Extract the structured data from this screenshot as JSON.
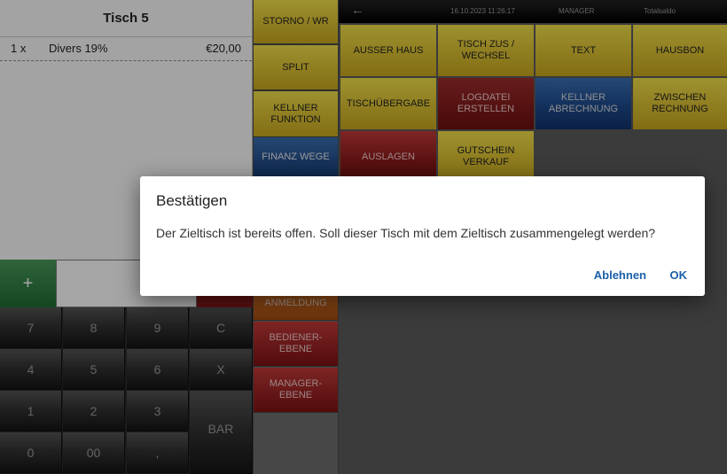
{
  "order": {
    "table_title": "Tisch 5",
    "rows": [
      {
        "qty": "1 x",
        "item": "Divers 19%",
        "price": "€20,00"
      }
    ]
  },
  "input": {
    "plus": "+"
  },
  "keypad": {
    "keys": [
      "7",
      "8",
      "9",
      "C",
      "4",
      "5",
      "6",
      "X",
      "1",
      "2",
      "3",
      "0",
      "00",
      ","
    ],
    "bar": "BAR"
  },
  "middle": {
    "storno": "STORNO / WR",
    "split": "SPLIT",
    "kellner_funktion": "KELLNER FUNKTION",
    "finanz_wege": "FINANZ WEGE",
    "anmeldung": "ANMELDUNG",
    "bediener_ebene": "BEDIENER-EBENE",
    "manager_ebene": "MANAGER-EBENE"
  },
  "status": {
    "datetime": "16.10.2023 11:26:17",
    "role": "MANAGER",
    "mode": "Totalsaldo"
  },
  "grid": {
    "ausser_haus": "AUSSER HAUS",
    "tisch_zus": "TISCH ZUS / WECHSEL",
    "text": "TEXT",
    "hausbon": "HAUSBON",
    "tischuebergabe": "TISCHÜBERGABE",
    "logdatei": "LOGDATEI ERSTELLEN",
    "kellner_abrechnung": "KELLNER ABRECHNUNG",
    "zwischen_rechnung": "ZWISCHEN RECHNUNG",
    "auslagen": "AUSLAGEN",
    "gutschein": "GUTSCHEIN VERKAUF"
  },
  "dialog": {
    "title": "Bestätigen",
    "message": "Der Zieltisch ist bereits offen. Soll dieser Tisch mit dem Zieltisch zusammengelegt werden?",
    "decline": "Ablehnen",
    "ok": "OK"
  },
  "colors": {
    "accent_yellow": "#e8d030",
    "accent_blue": "#1d4a8c",
    "accent_red": "#8f1c1c",
    "accent_green": "#2e7d3f",
    "dialog_button": "#1a5fa8"
  },
  "icons": {
    "back": "back-arrow-icon"
  }
}
